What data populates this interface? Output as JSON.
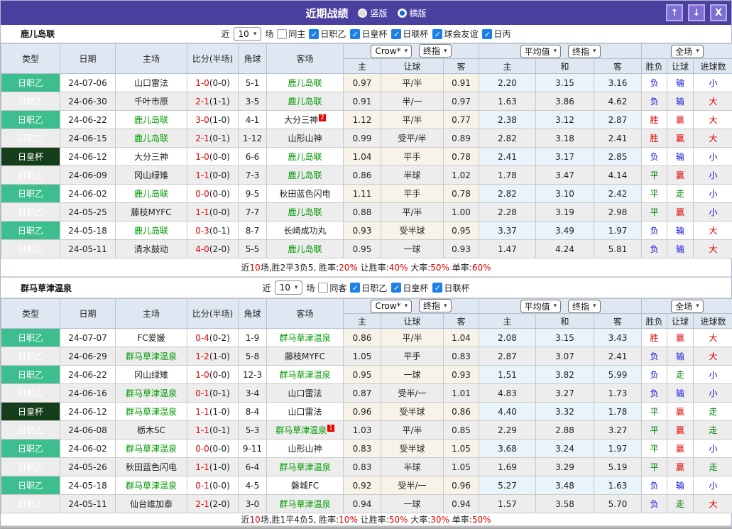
{
  "titlebar": {
    "title": "近期战绩",
    "radio_options": [
      {
        "label": "竖版",
        "selected": false
      },
      {
        "label": "横版",
        "selected": true
      }
    ],
    "window_buttons": {
      "up": "↑",
      "down": "↓",
      "close": "X"
    }
  },
  "colors": {
    "titlebar_bg": "#4b3f9f",
    "league_badge_green": "#3cbe8e",
    "cup_badge_dark_green": "#143d1a",
    "focus_team_green": "#009900",
    "win_red": "#e60000",
    "lose_blue": "#1414dd",
    "draw_green": "#008000",
    "header_bg": "#dfe8f2",
    "crow_columns_bg": "#f8f3e8",
    "average_columns_bg": "#e9f4fa"
  },
  "table_header": {
    "cols": [
      "类型",
      "日期",
      "主场",
      "比分(半场)",
      "角球",
      "客场"
    ],
    "crow_select": "Crow*",
    "crow_final_select": "终指",
    "crow_cols": [
      "主",
      "让球",
      "客"
    ],
    "avg_select": "平均值",
    "avg_final_select": "终指",
    "avg_cols": [
      "主",
      "和",
      "客"
    ],
    "full_select": "全场",
    "full_cols": [
      "胜负",
      "让球",
      "进球数"
    ]
  },
  "sections": [
    {
      "team": "鹿儿岛联",
      "filter": {
        "near": "近",
        "count": "10",
        "games": "场",
        "same": "同主",
        "leagues": [
          "日职乙",
          "日皇杯",
          "日联杯",
          "球会友谊",
          "日丙"
        ]
      },
      "rows": [
        {
          "type": "日职乙",
          "cup": false,
          "date": "24-07-06",
          "home": "山口雷法",
          "home_green": false,
          "score": "1-0",
          "half": "(0-0)",
          "corner": "5-1",
          "away": "鹿儿岛联",
          "away_green": true,
          "crow": [
            "0.97",
            "平/半",
            "0.91"
          ],
          "avg": [
            "2.20",
            "3.15",
            "3.16"
          ],
          "results": [
            {
              "text": "负",
              "color": "blue"
            },
            {
              "text": "输",
              "color": "blue"
            },
            {
              "text": "小",
              "color": "blue"
            }
          ]
        },
        {
          "type": "日职乙",
          "cup": false,
          "date": "24-06-30",
          "home": "千叶市原",
          "home_green": false,
          "score": "2-1",
          "half": "(1-1)",
          "corner": "3-5",
          "away": "鹿儿岛联",
          "away_green": true,
          "crow": [
            "0.91",
            "半/一",
            "0.97"
          ],
          "avg": [
            "1.63",
            "3.86",
            "4.62"
          ],
          "results": [
            {
              "text": "负",
              "color": "blue"
            },
            {
              "text": "输",
              "color": "blue"
            },
            {
              "text": "大",
              "color": "red"
            }
          ]
        },
        {
          "type": "日职乙",
          "cup": false,
          "date": "24-06-22",
          "home": "鹿儿岛联",
          "home_green": true,
          "score": "3-0",
          "half": "(1-0)",
          "corner": "4-1",
          "away": "大分三神",
          "away_green": false,
          "away_sup": "2",
          "crow": [
            "1.12",
            "平/半",
            "0.77"
          ],
          "avg": [
            "2.38",
            "3.12",
            "2.87"
          ],
          "results": [
            {
              "text": "胜",
              "color": "red"
            },
            {
              "text": "赢",
              "color": "red"
            },
            {
              "text": "大",
              "color": "red"
            }
          ]
        },
        {
          "type": "日职乙",
          "cup": false,
          "date": "24-06-15",
          "home": "鹿儿岛联",
          "home_green": true,
          "score": "2-1",
          "half": "(0-1)",
          "corner": "1-12",
          "away": "山形山神",
          "away_green": false,
          "crow": [
            "0.99",
            "受平/半",
            "0.89"
          ],
          "avg": [
            "2.82",
            "3.18",
            "2.41"
          ],
          "results": [
            {
              "text": "胜",
              "color": "red"
            },
            {
              "text": "赢",
              "color": "red"
            },
            {
              "text": "大",
              "color": "red"
            }
          ]
        },
        {
          "type": "日皇杯",
          "cup": true,
          "date": "24-06-12",
          "home": "大分三神",
          "home_green": false,
          "score": "1-0",
          "half": "(0-0)",
          "corner": "6-6",
          "away": "鹿儿岛联",
          "away_green": true,
          "crow": [
            "1.04",
            "平手",
            "0.78"
          ],
          "avg": [
            "2.41",
            "3.17",
            "2.85"
          ],
          "results": [
            {
              "text": "负",
              "color": "blue"
            },
            {
              "text": "输",
              "color": "blue"
            },
            {
              "text": "小",
              "color": "blue"
            }
          ]
        },
        {
          "type": "日职乙",
          "cup": false,
          "date": "24-06-09",
          "home": "冈山绿雉",
          "home_green": false,
          "score": "1-1",
          "half": "(0-0)",
          "corner": "7-3",
          "away": "鹿儿岛联",
          "away_green": true,
          "crow": [
            "0.86",
            "半球",
            "1.02"
          ],
          "avg": [
            "1.78",
            "3.47",
            "4.14"
          ],
          "results": [
            {
              "text": "平",
              "color": "green"
            },
            {
              "text": "赢",
              "color": "red"
            },
            {
              "text": "小",
              "color": "blue"
            }
          ]
        },
        {
          "type": "日职乙",
          "cup": false,
          "date": "24-06-02",
          "home": "鹿儿岛联",
          "home_green": true,
          "score": "0-0",
          "half": "(0-0)",
          "corner": "9-5",
          "away": "秋田蓝色闪电",
          "away_green": false,
          "crow": [
            "1.11",
            "平手",
            "0.78"
          ],
          "avg": [
            "2.82",
            "3.10",
            "2.42"
          ],
          "results": [
            {
              "text": "平",
              "color": "green"
            },
            {
              "text": "走",
              "color": "green"
            },
            {
              "text": "小",
              "color": "blue"
            }
          ]
        },
        {
          "type": "日职乙",
          "cup": false,
          "date": "24-05-25",
          "home": "藤枝MYFC",
          "home_green": false,
          "score": "1-1",
          "half": "(0-0)",
          "corner": "7-7",
          "away": "鹿儿岛联",
          "away_green": true,
          "crow": [
            "0.88",
            "平/半",
            "1.00"
          ],
          "avg": [
            "2.28",
            "3.19",
            "2.98"
          ],
          "results": [
            {
              "text": "平",
              "color": "green"
            },
            {
              "text": "赢",
              "color": "red"
            },
            {
              "text": "小",
              "color": "blue"
            }
          ]
        },
        {
          "type": "日职乙",
          "cup": false,
          "date": "24-05-18",
          "home": "鹿儿岛联",
          "home_green": true,
          "score": "0-3",
          "half": "(0-1)",
          "corner": "8-7",
          "away": "长崎成功丸",
          "away_green": false,
          "crow": [
            "0.93",
            "受半球",
            "0.95"
          ],
          "avg": [
            "3.37",
            "3.49",
            "1.97"
          ],
          "results": [
            {
              "text": "负",
              "color": "blue"
            },
            {
              "text": "输",
              "color": "blue"
            },
            {
              "text": "大",
              "color": "red"
            }
          ]
        },
        {
          "type": "日职乙",
          "cup": false,
          "date": "24-05-11",
          "home": "清水鼓动",
          "home_green": false,
          "score": "4-0",
          "half": "(2-0)",
          "corner": "5-5",
          "away": "鹿儿岛联",
          "away_green": true,
          "crow": [
            "0.95",
            "一球",
            "0.93"
          ],
          "avg": [
            "1.47",
            "4.24",
            "5.81"
          ],
          "results": [
            {
              "text": "负",
              "color": "blue"
            },
            {
              "text": "输",
              "color": "blue"
            },
            {
              "text": "大",
              "color": "red"
            }
          ]
        }
      ],
      "summary": [
        {
          "text": "近",
          "red": false
        },
        {
          "text": "10",
          "red": true
        },
        {
          "text": "场,胜2平3负5, 胜率:",
          "red": false
        },
        {
          "text": "20%",
          "red": true
        },
        {
          "text": " 让胜率:",
          "red": false
        },
        {
          "text": "40%",
          "red": true
        },
        {
          "text": " 大率:",
          "red": false
        },
        {
          "text": "50%",
          "red": true
        },
        {
          "text": " 单率:",
          "red": false
        },
        {
          "text": "60%",
          "red": true
        }
      ]
    },
    {
      "team": "群马草津温泉",
      "filter": {
        "near": "近",
        "count": "10",
        "games": "场",
        "same": "同客",
        "leagues": [
          "日职乙",
          "日皇杯",
          "日联杯"
        ]
      },
      "rows": [
        {
          "type": "日职乙",
          "cup": false,
          "date": "24-07-07",
          "home": "FC爱媛",
          "home_green": false,
          "score": "0-4",
          "half": "(0-2)",
          "corner": "1-9",
          "away": "群马草津温泉",
          "away_green": true,
          "crow": [
            "0.86",
            "平/半",
            "1.04"
          ],
          "avg": [
            "2.08",
            "3.15",
            "3.43"
          ],
          "results": [
            {
              "text": "胜",
              "color": "red"
            },
            {
              "text": "赢",
              "color": "red"
            },
            {
              "text": "大",
              "color": "red"
            }
          ]
        },
        {
          "type": "日职乙",
          "cup": false,
          "date": "24-06-29",
          "home": "群马草津温泉",
          "home_green": true,
          "score": "1-2",
          "half": "(1-0)",
          "corner": "5-8",
          "away": "藤枝MYFC",
          "away_green": false,
          "crow": [
            "1.05",
            "平手",
            "0.83"
          ],
          "avg": [
            "2.87",
            "3.07",
            "2.41"
          ],
          "results": [
            {
              "text": "负",
              "color": "blue"
            },
            {
              "text": "输",
              "color": "blue"
            },
            {
              "text": "大",
              "color": "red"
            }
          ]
        },
        {
          "type": "日职乙",
          "cup": false,
          "date": "24-06-22",
          "home": "冈山绿雉",
          "home_green": false,
          "score": "1-0",
          "half": "(0-0)",
          "corner": "12-3",
          "away": "群马草津温泉",
          "away_green": true,
          "crow": [
            "0.95",
            "一球",
            "0.93"
          ],
          "avg": [
            "1.51",
            "3.82",
            "5.99"
          ],
          "results": [
            {
              "text": "负",
              "color": "blue"
            },
            {
              "text": "走",
              "color": "green"
            },
            {
              "text": "小",
              "color": "blue"
            }
          ]
        },
        {
          "type": "日职乙",
          "cup": false,
          "date": "24-06-16",
          "home": "群马草津温泉",
          "home_green": true,
          "score": "0-1",
          "half": "(0-1)",
          "corner": "3-4",
          "away": "山口雷法",
          "away_green": false,
          "crow": [
            "0.87",
            "受半/一",
            "1.01"
          ],
          "avg": [
            "4.83",
            "3.27",
            "1.73"
          ],
          "results": [
            {
              "text": "负",
              "color": "blue"
            },
            {
              "text": "输",
              "color": "blue"
            },
            {
              "text": "小",
              "color": "blue"
            }
          ]
        },
        {
          "type": "日皇杯",
          "cup": true,
          "date": "24-06-12",
          "home": "群马草津温泉",
          "home_green": true,
          "score": "1-1",
          "half": "(1-0)",
          "corner": "8-4",
          "away": "山口雷法",
          "away_green": false,
          "crow": [
            "0.96",
            "受半球",
            "0.86"
          ],
          "avg": [
            "4.40",
            "3.32",
            "1.78"
          ],
          "results": [
            {
              "text": "平",
              "color": "green"
            },
            {
              "text": "赢",
              "color": "red"
            },
            {
              "text": "走",
              "color": "green"
            }
          ]
        },
        {
          "type": "日职乙",
          "cup": false,
          "date": "24-06-08",
          "home": "栃木SC",
          "home_green": false,
          "score": "1-1",
          "half": "(0-1)",
          "corner": "5-3",
          "away": "群马草津温泉",
          "away_green": true,
          "away_sup": "1",
          "crow": [
            "1.03",
            "平/半",
            "0.85"
          ],
          "avg": [
            "2.29",
            "2.88",
            "3.27"
          ],
          "results": [
            {
              "text": "平",
              "color": "green"
            },
            {
              "text": "赢",
              "color": "red"
            },
            {
              "text": "走",
              "color": "green"
            }
          ]
        },
        {
          "type": "日职乙",
          "cup": false,
          "date": "24-06-02",
          "home": "群马草津温泉",
          "home_green": true,
          "score": "0-0",
          "half": "(0-0)",
          "corner": "9-11",
          "away": "山形山神",
          "away_green": false,
          "crow": [
            "0.83",
            "受半球",
            "1.05"
          ],
          "avg": [
            "3.68",
            "3.24",
            "1.97"
          ],
          "results": [
            {
              "text": "平",
              "color": "green"
            },
            {
              "text": "赢",
              "color": "red"
            },
            {
              "text": "小",
              "color": "blue"
            }
          ]
        },
        {
          "type": "日职乙",
          "cup": false,
          "date": "24-05-26",
          "home": "秋田蓝色闪电",
          "home_green": false,
          "score": "1-1",
          "half": "(1-0)",
          "corner": "6-4",
          "away": "群马草津温泉",
          "away_green": true,
          "crow": [
            "0.83",
            "半球",
            "1.05"
          ],
          "avg": [
            "1.69",
            "3.29",
            "5.19"
          ],
          "results": [
            {
              "text": "平",
              "color": "green"
            },
            {
              "text": "赢",
              "color": "red"
            },
            {
              "text": "走",
              "color": "green"
            }
          ]
        },
        {
          "type": "日职乙",
          "cup": false,
          "date": "24-05-18",
          "home": "群马草津温泉",
          "home_green": true,
          "score": "0-1",
          "half": "(0-0)",
          "corner": "4-5",
          "away": "磐城FC",
          "away_green": false,
          "crow": [
            "0.92",
            "受半/一",
            "0.96"
          ],
          "avg": [
            "5.27",
            "3.48",
            "1.63"
          ],
          "results": [
            {
              "text": "负",
              "color": "blue"
            },
            {
              "text": "输",
              "color": "blue"
            },
            {
              "text": "小",
              "color": "blue"
            }
          ]
        },
        {
          "type": "日职乙",
          "cup": false,
          "date": "24-05-11",
          "home": "仙台维加泰",
          "home_green": false,
          "score": "2-1",
          "half": "(2-0)",
          "corner": "3-0",
          "away": "群马草津温泉",
          "away_green": true,
          "crow": [
            "0.94",
            "一球",
            "0.94"
          ],
          "avg": [
            "1.57",
            "3.58",
            "5.70"
          ],
          "results": [
            {
              "text": "负",
              "color": "blue"
            },
            {
              "text": "走",
              "color": "green"
            },
            {
              "text": "大",
              "color": "red"
            }
          ]
        }
      ],
      "summary": [
        {
          "text": "近",
          "red": false
        },
        {
          "text": "10",
          "red": true
        },
        {
          "text": "场,胜1平4负5, 胜率:",
          "red": false
        },
        {
          "text": "10%",
          "red": true
        },
        {
          "text": " 让胜率:",
          "red": false
        },
        {
          "text": "50%",
          "red": true
        },
        {
          "text": " 大率:",
          "red": false
        },
        {
          "text": "30%",
          "red": true
        },
        {
          "text": " 单率:",
          "red": false
        },
        {
          "text": "50%",
          "red": true
        }
      ]
    }
  ]
}
